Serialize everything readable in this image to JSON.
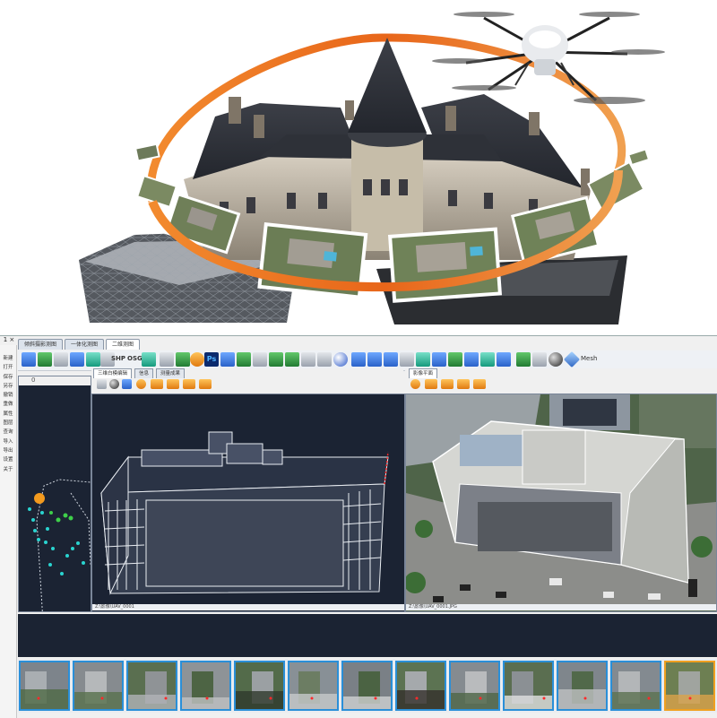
{
  "window": {
    "mini_controls": "1 ×",
    "tabs": [
      {
        "label": "倾斜摄影测图",
        "active": false
      },
      {
        "label": "一体化测图",
        "active": false
      },
      {
        "label": "二维测图",
        "active": true
      }
    ],
    "toolbar_text": {
      "shp": "SHP",
      "osg": "OSG",
      "mesh": "Mesh"
    }
  },
  "left_menu": [
    "新建",
    "打开",
    "保存",
    "另存",
    "撤销",
    "重做",
    "属性",
    "图层",
    "查询",
    "导入",
    "导出",
    "设置",
    "关于"
  ],
  "left_panel": {
    "top_value": "0"
  },
  "panels": {
    "model_3d": {
      "tabs": [
        {
          "label": "三维白模编辑",
          "active": true
        },
        {
          "label": "信息",
          "active": false
        },
        {
          "label": "测量成果",
          "active": false
        }
      ],
      "status": "Z:\\影像\\UAV_0001"
    },
    "photo": {
      "tabs": [
        {
          "label": "影像平面",
          "active": true
        }
      ],
      "status": "Z:\\影像\\UAV_0001.JPG"
    }
  },
  "filmstrip": {
    "count": 13,
    "selected_index": 12
  },
  "colors": {
    "orbit_ring": "#e87722",
    "panel_bg": "#1b2333",
    "thumb_border": "#2a8fd8",
    "thumb_selected": "#f0a020",
    "waypoint": "#2ad4d0"
  }
}
